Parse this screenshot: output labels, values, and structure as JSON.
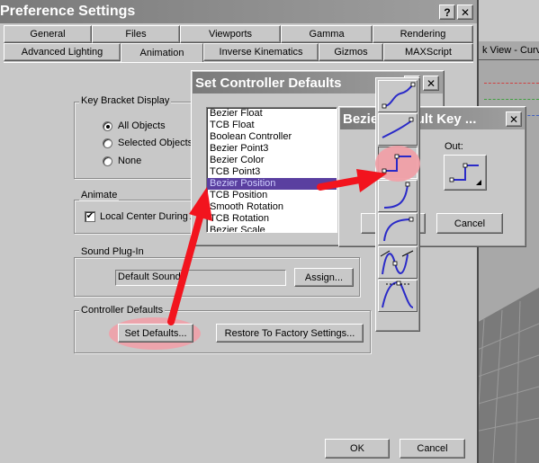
{
  "pref_window": {
    "title": "Preference Settings",
    "help_label": "?",
    "close_label": "✕",
    "tabs_row1": [
      "General",
      "Files",
      "Viewports",
      "Gamma",
      "Rendering"
    ],
    "tabs_row2": [
      "Advanced Lighting",
      "Animation",
      "Inverse Kinematics",
      "Gizmos",
      "MAXScript"
    ],
    "active_tab": "Animation"
  },
  "key_bracket": {
    "title": "Key Bracket Display",
    "options": [
      "All Objects",
      "Selected Objects",
      "None"
    ],
    "selected": "All Objects"
  },
  "animate": {
    "title": "Animate",
    "local_center_label": "Local Center During A",
    "local_center_checked": true
  },
  "sound": {
    "title": "Sound Plug-In",
    "field_value": "Default Sound",
    "assign_label": "Assign..."
  },
  "controller_defaults": {
    "title": "Controller Defaults",
    "set_defaults_label": "Set Defaults...",
    "restore_label": "Restore To Factory Settings..."
  },
  "footer": {
    "ok_label": "OK",
    "cancel_label": "Cancel"
  },
  "set_ctrl_dialog": {
    "title": "Set Controller Defaults",
    "help_label": "?",
    "close_label": "✕",
    "items": [
      "Bezier Float",
      "TCB Float",
      "Boolean Controller",
      "Bezier Point3",
      "Bezier Color",
      "TCB Point3",
      "Bezier Position",
      "TCB Position",
      "Smooth Rotation",
      "TCB Rotation",
      "Bezier Scale"
    ],
    "selected_item": "Bezier Position"
  },
  "bezier_dialog": {
    "title": "Bezier Default Key ...",
    "close_label": "✕",
    "out_label": "Out:",
    "cancel_label": "Cancel"
  },
  "viewport_bg": {
    "label": "k View - Curve"
  },
  "tangent_palette": {
    "icons": [
      "smooth-tangent-icon",
      "linear-tangent-icon",
      "step-tangent-icon",
      "slow-tangent-icon",
      "fast-tangent-icon",
      "custom-tangent-icon",
      "auto-tangent-icon"
    ],
    "selected_index": 2
  },
  "colors": {
    "highlight_red": "#f2141e",
    "selection_purple": "#5a3fa0",
    "annotation_pink": "#f0a0a8"
  }
}
